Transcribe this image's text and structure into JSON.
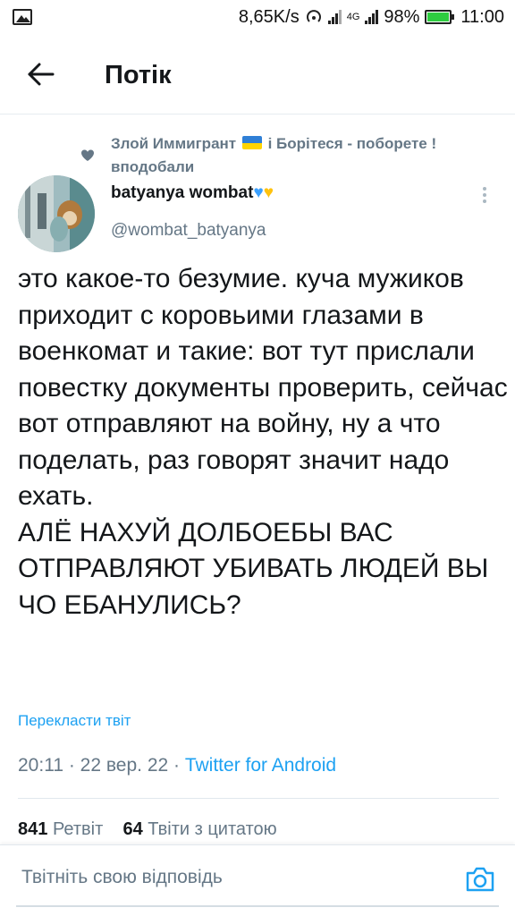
{
  "status_bar": {
    "speed": "8,65K/s",
    "network": "4G",
    "battery_percent": "98%",
    "battery_level": 0.98,
    "time": "11:00"
  },
  "app_bar": {
    "title": "Потік",
    "back_icon": "arrow-left-icon"
  },
  "social_context": {
    "icon": "heart-icon",
    "user": "Злой Иммигрант",
    "motto": "і Борітеся - поборете !",
    "action": "вподобали"
  },
  "author": {
    "name": "batyanya wombat",
    "hearts": [
      "💙",
      "💛"
    ],
    "handle": "@wombat_batyanya"
  },
  "tweet": {
    "text": "это какое-то безумие. куча мужиков приходит с коровьими глазами в военкомат и такие: вот тут прислали повестку документы проверить, сейчас вот отправляют на войну, ну а что поделать, раз говорят значит надо ехать.\nАЛЁ НАХУЙ ДОЛБОЕБЫ ВАС ОТПРАВЛЯЮТ УБИВАТЬ ЛЮДЕЙ ВЫ ЧО ЕБАНУЛИСЬ?",
    "translate_label": "Перекласти твіт",
    "time": "20:11",
    "date": "22 вер. 22",
    "source": "Twitter for Android"
  },
  "stats": {
    "retweets": "841",
    "retweets_label": "Ретвіт",
    "quotes": "64",
    "quotes_label": "Твіти з цитатою"
  },
  "reply": {
    "placeholder": "Твітніть свою відповідь",
    "camera_icon": "camera-icon"
  },
  "colors": {
    "accent": "#1da1f2",
    "secondary_text": "#657786",
    "primary_text": "#14171a"
  }
}
